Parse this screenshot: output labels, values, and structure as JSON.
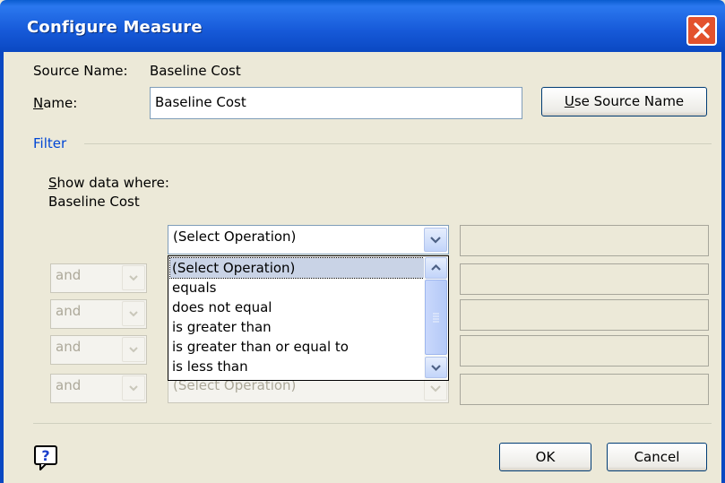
{
  "window": {
    "title": "Configure Measure"
  },
  "source": {
    "label": "Source Name:",
    "value": "Baseline Cost"
  },
  "name_field": {
    "label": "Name:",
    "value": "Baseline Cost"
  },
  "buttons": {
    "use_source_name": "Use Source Name",
    "ok": "OK",
    "cancel": "Cancel"
  },
  "filter": {
    "group_label": "Filter",
    "show_label": "Show data where:",
    "field_name": "Baseline Cost",
    "operation_value": "(Select Operation)",
    "conjunctions": [
      "and",
      "and",
      "and",
      "and"
    ],
    "disabled_operation_value": "(Select Operation)"
  },
  "dropdown": {
    "options": [
      "(Select Operation)",
      "equals",
      "does not equal",
      "is greater than",
      "is greater than or equal to",
      "is less than"
    ],
    "selected_index": 0
  },
  "colors": {
    "title_bar": "#0a5ccf",
    "close_button": "#e3512c",
    "dialog_bg": "#ece9d8",
    "selection": "#c9d3e6",
    "group_label": "#0046d5"
  },
  "icons": {
    "close": "close-icon",
    "help": "help-icon",
    "dropdown": "chevron-down-icon",
    "scroll_up": "chevron-up-icon",
    "scroll_down": "chevron-down-icon"
  }
}
